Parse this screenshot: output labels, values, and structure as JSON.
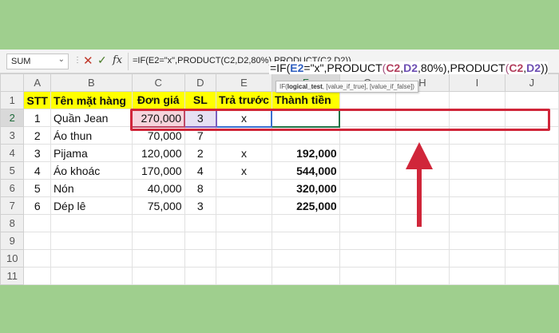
{
  "formula_bar": {
    "name_box": "SUM",
    "formula": "=IF(E2=\"x\",PRODUCT(C2,D2,80%),PRODUCT(C2,D2))"
  },
  "columns": [
    "A",
    "B",
    "C",
    "D",
    "E",
    "F",
    "G",
    "H",
    "I",
    "J"
  ],
  "rows": [
    "1",
    "2",
    "3",
    "4",
    "5",
    "6",
    "7",
    "8",
    "9",
    "10",
    "11"
  ],
  "table": {
    "headers": [
      "STT",
      "Tên mặt hàng",
      "Đơn giá",
      "SL",
      "Trả trước",
      "Thành tiền"
    ],
    "data": [
      [
        "1",
        "Quần Jean",
        "270,000",
        "3",
        "x",
        ""
      ],
      [
        "2",
        "Áo thun",
        "70,000",
        "7",
        "",
        ""
      ],
      [
        "3",
        "Pijama",
        "120,000",
        "2",
        "x",
        "192,000"
      ],
      [
        "4",
        "Áo khoác",
        "170,000",
        "4",
        "x",
        "544,000"
      ],
      [
        "5",
        "Nón",
        "40,000",
        "8",
        "",
        "320,000"
      ],
      [
        "6",
        "Dép lê",
        "75,000",
        "3",
        "",
        "225,000"
      ]
    ]
  },
  "edit_cell": {
    "p1": "=IF(",
    "ref1": "E2",
    "p2": "=\"x\",PRODUCT",
    "par_open": "(",
    "ref2": "C2",
    "comma1": ",",
    "ref3": "D2",
    "p3": ",80%),PRODUCT",
    "par_open2": "(",
    "ref4": "C2",
    "comma2": ",",
    "ref5": "D2",
    "par_close": "))"
  },
  "tooltip": {
    "fn": "IF(",
    "arg1": "logical_test",
    "rest": ", [value_if_true], [value_if_false])"
  },
  "colors": {
    "highlight": "#d0263a",
    "header_fill": "#ffff00",
    "excel_green": "#217346"
  }
}
